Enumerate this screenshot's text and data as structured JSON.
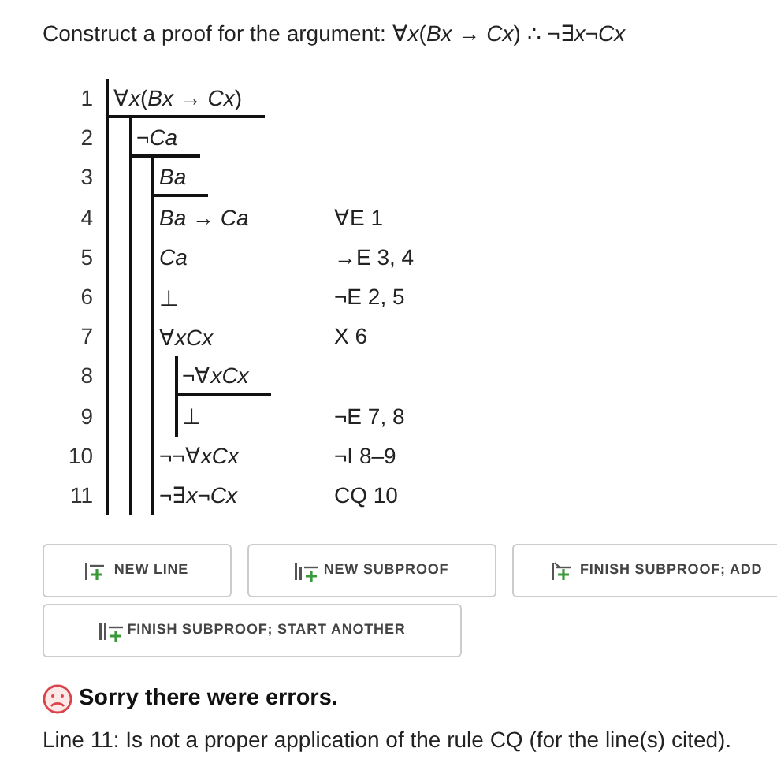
{
  "prompt": "Construct a proof for the argument: ∀*x*(*Bx* → *Cx*) ∴ ¬∃*x*¬*Cx*",
  "proof": [
    {
      "kind": "line",
      "number": "1",
      "formula": "∀*x*(*Bx* → *Cx*)",
      "assumption": true
    },
    {
      "kind": "subproof",
      "children": [
        {
          "kind": "line",
          "number": "2",
          "formula": "¬*Ca*",
          "assumption": true
        },
        {
          "kind": "subproof",
          "children": [
            {
              "kind": "line",
              "number": "3",
              "formula": "*Ba*",
              "assumption": true
            },
            {
              "kind": "line",
              "number": "4",
              "formula": "*Ba* → *Ca*",
              "assumption": false,
              "rule": "∀E 1"
            },
            {
              "kind": "line",
              "number": "5",
              "formula": "*Ca*",
              "assumption": false,
              "rule": "→E 3, 4"
            },
            {
              "kind": "line",
              "number": "6",
              "formula": "⊥",
              "assumption": false,
              "rule": "¬E 2, 5"
            },
            {
              "kind": "line",
              "number": "7",
              "formula": "∀*xCx*",
              "assumption": false,
              "rule": "X 6"
            },
            {
              "kind": "subproof",
              "children": [
                {
                  "kind": "line",
                  "number": "8",
                  "formula": "¬∀*xCx*",
                  "assumption": true
                },
                {
                  "kind": "line",
                  "number": "9",
                  "formula": "⊥",
                  "assumption": false,
                  "rule": "¬E 7, 8"
                }
              ]
            },
            {
              "kind": "line",
              "number": "10",
              "formula": "¬¬∀*xCx*",
              "assumption": false,
              "rule": "¬I 8–9"
            },
            {
              "kind": "line",
              "number": "11",
              "formula": "¬∃*x*¬*Cx*",
              "assumption": false,
              "rule": "CQ 10"
            }
          ]
        }
      ]
    }
  ],
  "buttons": [
    {
      "label": "NEW LINE",
      "kind": "line"
    },
    {
      "label": "NEW SUBPROOF",
      "kind": "subproof"
    },
    {
      "label": "FINISH SUBPROOF; ADD",
      "kind": "finish"
    },
    {
      "label": "FINISH SUBPROOF; START ANOTHER",
      "kind": "another"
    }
  ],
  "result": {
    "failed": true,
    "heading": "Sorry there were errors.",
    "message": "Line 11: Is not a proper application of the rule CQ (for the line(s) cited)."
  }
}
